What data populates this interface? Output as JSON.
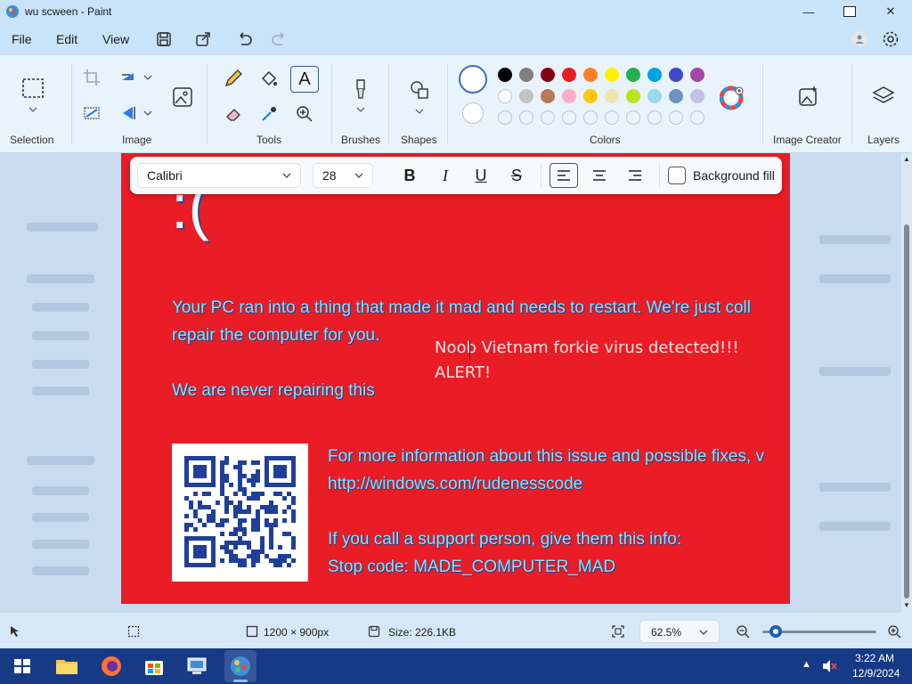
{
  "window": {
    "title": "wu scween - Paint"
  },
  "menu": {
    "file": "File",
    "edit": "Edit",
    "view": "View"
  },
  "ribbon": {
    "groups": {
      "selection": "Selection",
      "image": "Image",
      "tools": "Tools",
      "brushes": "Brushes",
      "shapes": "Shapes",
      "colors": "Colors",
      "image_creator": "Image Creator",
      "layers": "Layers"
    },
    "palette_row1": [
      "#000000",
      "#7f7f7f",
      "#880015",
      "#ed1c24",
      "#ff7f27",
      "#fff200",
      "#22b14c",
      "#00a2e8",
      "#3f48cc",
      "#a349a4"
    ],
    "palette_row2": [
      "#ffffff",
      "#c3c3c3",
      "#b97a57",
      "#ffaec9",
      "#ffc90e",
      "#efe4b0",
      "#b5e61d",
      "#99d9ea",
      "#7092be",
      "#c8bfe7"
    ]
  },
  "text_toolbar": {
    "font": "Calibri",
    "size": "28",
    "background_fill": "Background fill"
  },
  "canvas": {
    "sad_face": ":(",
    "line1": "Your PC ran into a thing that made it mad and needs to restart. We're just coll",
    "line2": "repair the computer for you.",
    "line3": "We are never repairing this",
    "overlay1": "Noob Vietnam forkie virus detected!!!",
    "overlay2": "ALERT!",
    "info1": "For more information about this issue and possible fixes, v",
    "info2": "http://windows.com/rudenesscode",
    "info3": "If you call a support person, give them this info:",
    "info4": "Stop code: MADE_COMPUTER_MAD"
  },
  "status": {
    "dimensions": "1200 × 900px",
    "size": "Size: 226.1KB",
    "zoom": "62.5%",
    "zoom_level": 0.12
  },
  "clock": {
    "time": "3:22 AM",
    "date": "12/9/2024"
  }
}
